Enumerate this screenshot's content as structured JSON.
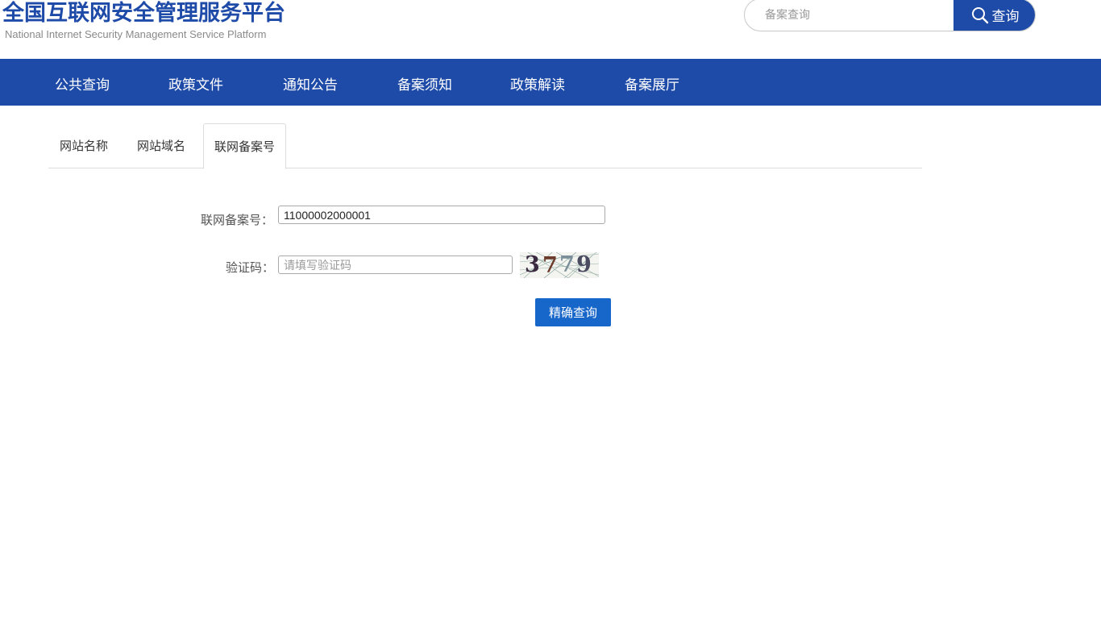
{
  "header": {
    "title": "全国互联网安全管理服务平台",
    "subtitle": "National Internet Security Management Service Platform"
  },
  "search": {
    "placeholder": "备案查询",
    "button_label": "查询",
    "icon": "search-icon"
  },
  "nav": {
    "items": [
      {
        "label": "公共查询"
      },
      {
        "label": "政策文件"
      },
      {
        "label": "通知公告"
      },
      {
        "label": "备案须知"
      },
      {
        "label": "政策解读"
      },
      {
        "label": "备案展厅"
      }
    ]
  },
  "tabs": [
    {
      "label": "网站名称",
      "active": false
    },
    {
      "label": "网站域名",
      "active": false
    },
    {
      "label": "联网备案号",
      "active": true
    }
  ],
  "form": {
    "record_label": "联网备案号：",
    "record_value": "11000002000001",
    "captcha_label": "验证码：",
    "captcha_placeholder": "请填写验证码",
    "captcha_text": "3779",
    "submit_label": "精确查询"
  },
  "colors": {
    "brand": "#1e4aa8",
    "button": "#1766c9"
  }
}
